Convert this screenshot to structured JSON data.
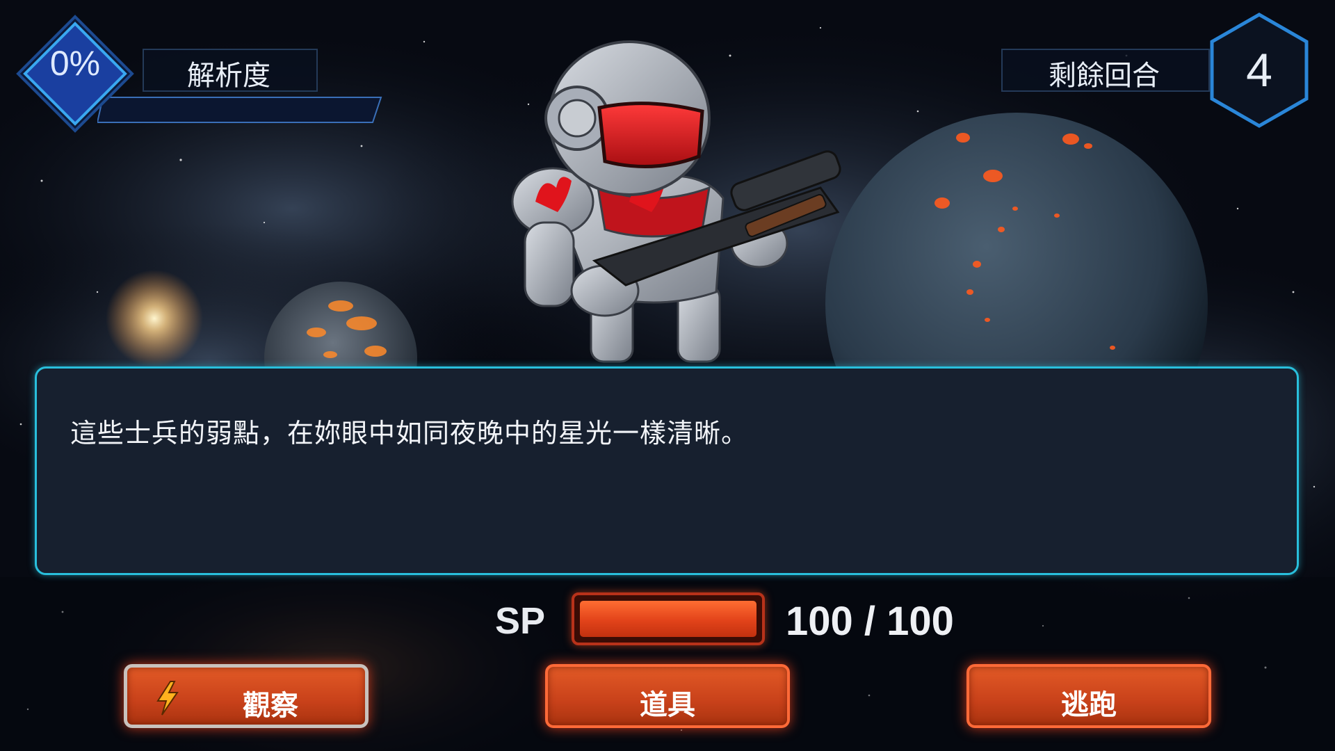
{
  "hud": {
    "analysis": {
      "percent": "0%",
      "label": "解析度",
      "level": 0
    },
    "turns": {
      "label": "剩餘回合",
      "value": "4"
    }
  },
  "dialog": {
    "text": "這些士兵的弱點，在妳眼中如同夜晚中的星光一樣清晰。"
  },
  "sp": {
    "label": "SP",
    "current": 100,
    "max": 100,
    "display": "100 / 100"
  },
  "commands": [
    {
      "label": "觀察",
      "icon": "lightning-bolt-icon",
      "selected": true
    },
    {
      "label": "道具",
      "selected": false
    },
    {
      "label": "逃跑",
      "selected": false
    }
  ],
  "colors": {
    "accent_cyan": "#29bfdc",
    "button_orange": "#d9501f",
    "analysis_blue": "#1a3fa0",
    "dialog_bg": "#17202f"
  }
}
